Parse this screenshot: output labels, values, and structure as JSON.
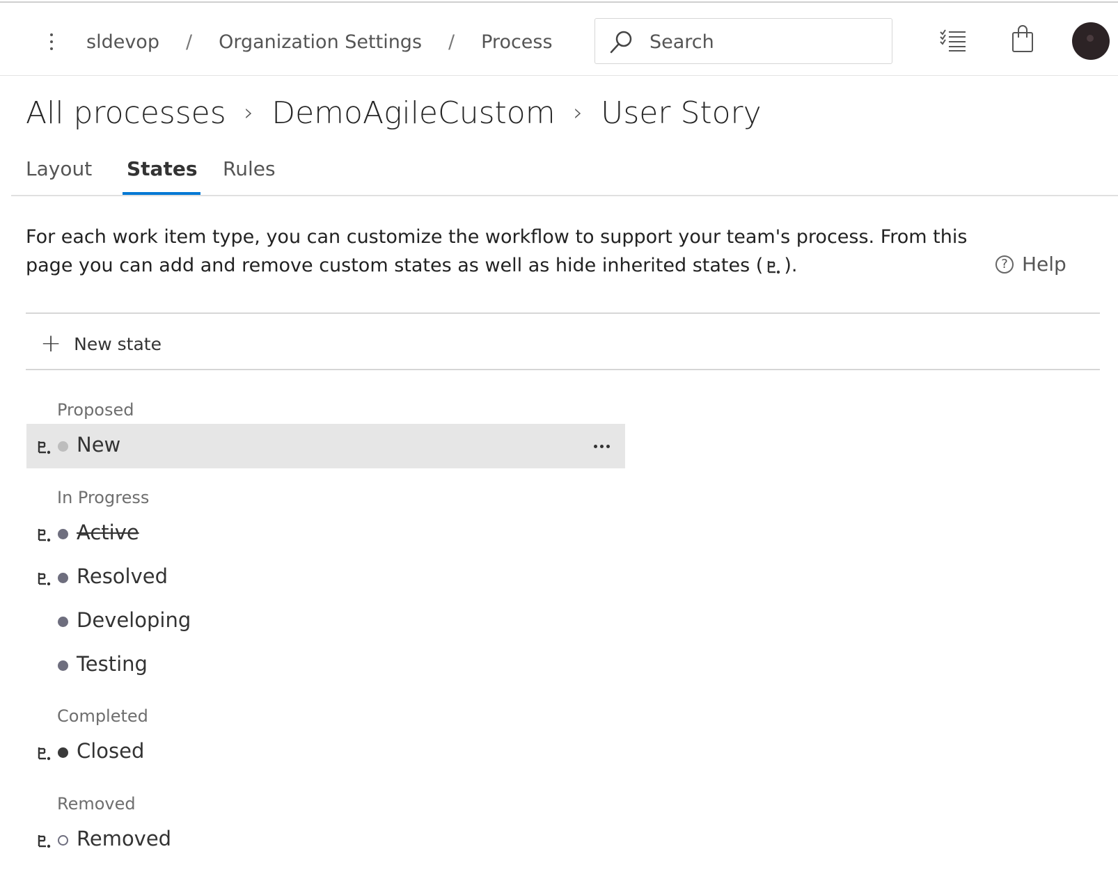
{
  "header": {
    "breadcrumb": [
      "sldevop",
      "Organization Settings",
      "Process"
    ],
    "search_placeholder": "Search"
  },
  "page": {
    "title_parts": [
      "All processes",
      "DemoAgileCustom",
      "User Story"
    ]
  },
  "tabs": [
    {
      "label": "Layout",
      "active": false
    },
    {
      "label": "States",
      "active": true
    },
    {
      "label": "Rules",
      "active": false
    }
  ],
  "description": {
    "line1": "For each work item type, you can customize the workflow to support your team's process. From this",
    "line2_before": "page you can add and remove custom states as well as hide inherited states (",
    "line2_after": ")."
  },
  "help_label": "Help",
  "new_state_label": "New state",
  "categories": [
    {
      "name": "Proposed",
      "states": [
        {
          "label": "New",
          "inherited": true,
          "hidden": false,
          "dot": "#bdbdbd",
          "selected": true
        }
      ]
    },
    {
      "name": "In Progress",
      "states": [
        {
          "label": "Active",
          "inherited": true,
          "hidden": true,
          "dot": "#6e6e7e",
          "selected": false
        },
        {
          "label": "Resolved",
          "inherited": true,
          "hidden": false,
          "dot": "#6e6e7e",
          "selected": false
        },
        {
          "label": "Developing",
          "inherited": false,
          "hidden": false,
          "dot": "#6e6e7e",
          "selected": false
        },
        {
          "label": "Testing",
          "inherited": false,
          "hidden": false,
          "dot": "#6e6e7e",
          "selected": false
        }
      ]
    },
    {
      "name": "Completed",
      "states": [
        {
          "label": "Closed",
          "inherited": true,
          "hidden": false,
          "dot": "#3a3a3a",
          "selected": false
        }
      ]
    },
    {
      "name": "Removed",
      "states": [
        {
          "label": "Removed",
          "inherited": true,
          "hidden": false,
          "dot": "hollow",
          "selected": false
        }
      ]
    }
  ]
}
